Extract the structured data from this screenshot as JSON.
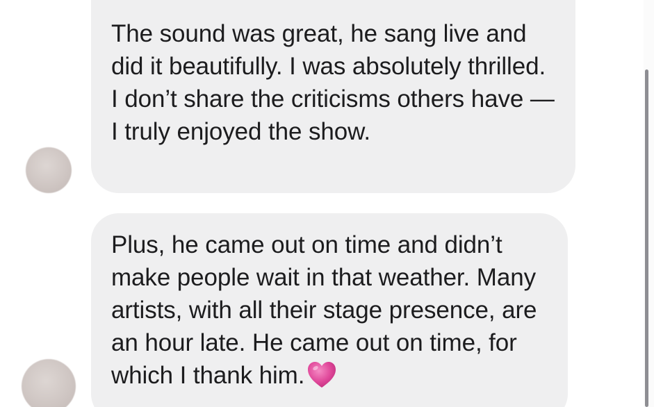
{
  "messages": [
    {
      "text": "The sound was great, he sang live and did it beautifully. I was absolutely thrilled. I don’t share the criticisms others have — I truly enjoyed the show.",
      "avatar": "blurred"
    },
    {
      "text": "Plus, he came out on time and didn’t make people wait in that weather. Many artists, with all their stage presence, are an hour late. He came out on time, for which I thank him.",
      "emoji": "pink-heart",
      "avatar": "blurred"
    }
  ],
  "colors": {
    "bubble": "#efeff0",
    "text": "#1c1c1e",
    "heart": "#e0489a",
    "scrollbar": "#8e8e93"
  }
}
